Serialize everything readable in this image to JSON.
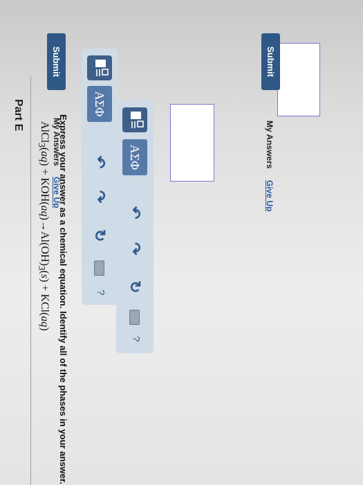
{
  "top_section": {
    "toolbar": {
      "greek_label": "ΑΣΦ",
      "help_label": "?"
    },
    "submit_label": "Submit",
    "my_answers_label": "My Answers",
    "give_up_label": "Give Up"
  },
  "part_e": {
    "title": "Part E",
    "equation": {
      "reactant1": "AlCl",
      "reactant1_sub": "3",
      "reactant1_phase": "aq",
      "plus1": " + ",
      "reactant2": "KOH",
      "reactant2_phase": "aq",
      "arrow": "→",
      "product1": "Al(OH)",
      "product1_sub": "3",
      "product1_phase": "s",
      "plus2": " + ",
      "product2": "KCl",
      "product2_phase": "aq"
    },
    "instructions": "Express your answer as a chemical equation. Identify all of the phases in your answer.",
    "toolbar": {
      "greek_label": "ΑΣΦ",
      "help_label": "?"
    },
    "submit_label": "Submit",
    "my_answers_label": "My Answers",
    "give_up_label": "Give Up"
  },
  "colors": {
    "submit_bg": "#2f5886",
    "toolbar_bg": "#cfdbe6",
    "template_button_bg": "#3f5f8a",
    "greek_button_bg": "#567aa8",
    "link": "#2b5aa0",
    "answer_border": "#7e77cc"
  },
  "icons": [
    "template-icon",
    "undo-icon",
    "redo-icon",
    "reset-icon",
    "keyboard-icon",
    "help-icon"
  ]
}
